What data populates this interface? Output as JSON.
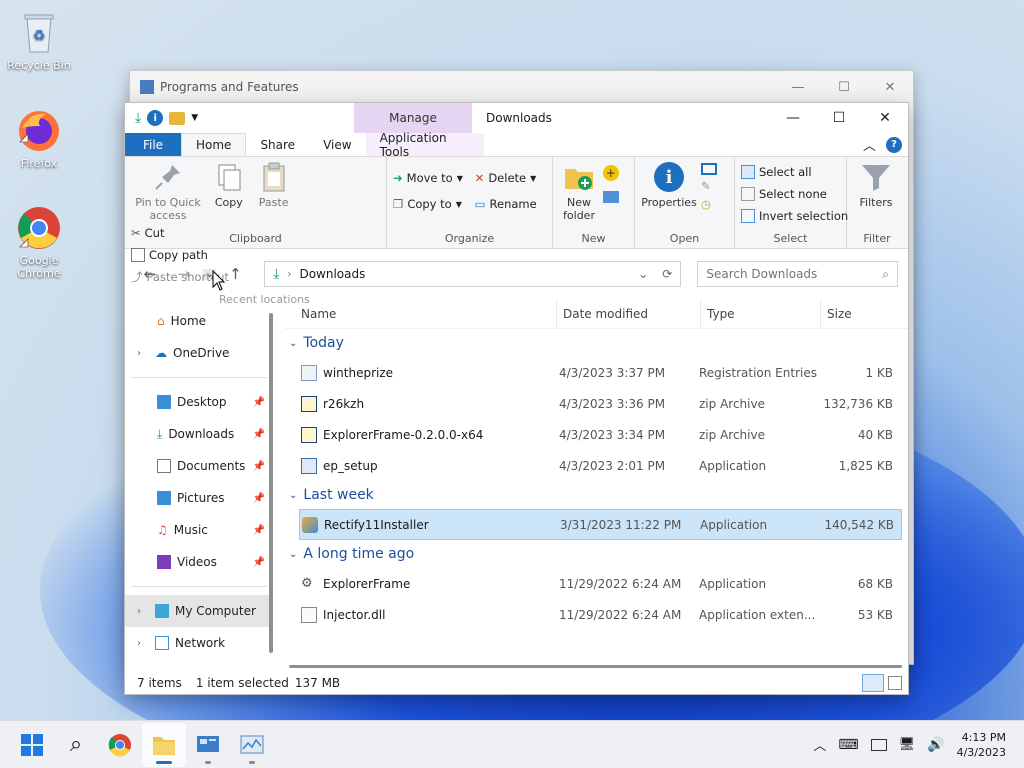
{
  "desktop": {
    "icons": [
      {
        "label": "Recycle Bin",
        "icon": "recycle-bin-icon"
      },
      {
        "label": "Firefox",
        "icon": "firefox-icon"
      },
      {
        "label": "Google Chrome",
        "icon": "chrome-icon"
      }
    ]
  },
  "background_window": {
    "title": "Programs and Features"
  },
  "explorer": {
    "title": "Downloads",
    "context_tab": "Manage",
    "tabs": [
      "File",
      "Home",
      "Share",
      "View",
      "Application Tools"
    ],
    "ribbon": {
      "clipboard": {
        "label": "Clipboard",
        "pin": "Pin to Quick access",
        "copy": "Copy",
        "paste": "Paste",
        "cut": "Cut",
        "copy_path": "Copy path",
        "paste_shortcut": "Paste shortcut"
      },
      "organize": {
        "label": "Organize",
        "move_to": "Move to",
        "copy_to": "Copy to",
        "delete": "Delete",
        "rename": "Rename"
      },
      "new": {
        "label": "New",
        "new_folder": "New folder"
      },
      "open": {
        "label": "Open",
        "properties": "Properties"
      },
      "select": {
        "label": "Select",
        "select_all": "Select all",
        "select_none": "Select none",
        "invert": "Invert selection"
      },
      "filter": {
        "label": "Filter",
        "filters": "Filters"
      }
    },
    "address": {
      "path": "Downloads"
    },
    "search": {
      "placeholder": "Search Downloads"
    },
    "tooltip": "Recent locations",
    "nav": {
      "home": "Home",
      "onedrive": "OneDrive",
      "desktop": "Desktop",
      "downloads": "Downloads",
      "documents": "Documents",
      "pictures": "Pictures",
      "music": "Music",
      "videos": "Videos",
      "my_computer": "My Computer",
      "network": "Network"
    },
    "columns": {
      "name": "Name",
      "date": "Date modified",
      "type": "Type",
      "size": "Size"
    },
    "groups": {
      "today": {
        "label": "Today",
        "files": [
          {
            "name": "wintheprize",
            "date": "4/3/2023 3:37 PM",
            "type": "Registration Entries",
            "size": "1 KB"
          },
          {
            "name": "r26kzh",
            "date": "4/3/2023 3:36 PM",
            "type": "zip Archive",
            "size": "132,736 KB"
          },
          {
            "name": "ExplorerFrame-0.2.0.0-x64",
            "date": "4/3/2023 3:34 PM",
            "type": "zip Archive",
            "size": "40 KB"
          },
          {
            "name": "ep_setup",
            "date": "4/3/2023 2:01 PM",
            "type": "Application",
            "size": "1,825 KB"
          }
        ]
      },
      "last_week": {
        "label": "Last week",
        "files": [
          {
            "name": "Rectify11Installer",
            "date": "3/31/2023 11:22 PM",
            "type": "Application",
            "size": "140,542 KB"
          }
        ]
      },
      "long_ago": {
        "label": "A long time ago",
        "files": [
          {
            "name": "ExplorerFrame",
            "date": "11/29/2022 6:24 AM",
            "type": "Application",
            "size": "68 KB"
          },
          {
            "name": "Injector.dll",
            "date": "11/29/2022 6:24 AM",
            "type": "Application exten...",
            "size": "53 KB"
          }
        ]
      }
    },
    "status": {
      "items": "7 items",
      "selected": "1 item selected",
      "size": "137 MB"
    }
  },
  "taskbar": {
    "clock_time": "4:13 PM",
    "clock_date": "4/3/2023"
  }
}
